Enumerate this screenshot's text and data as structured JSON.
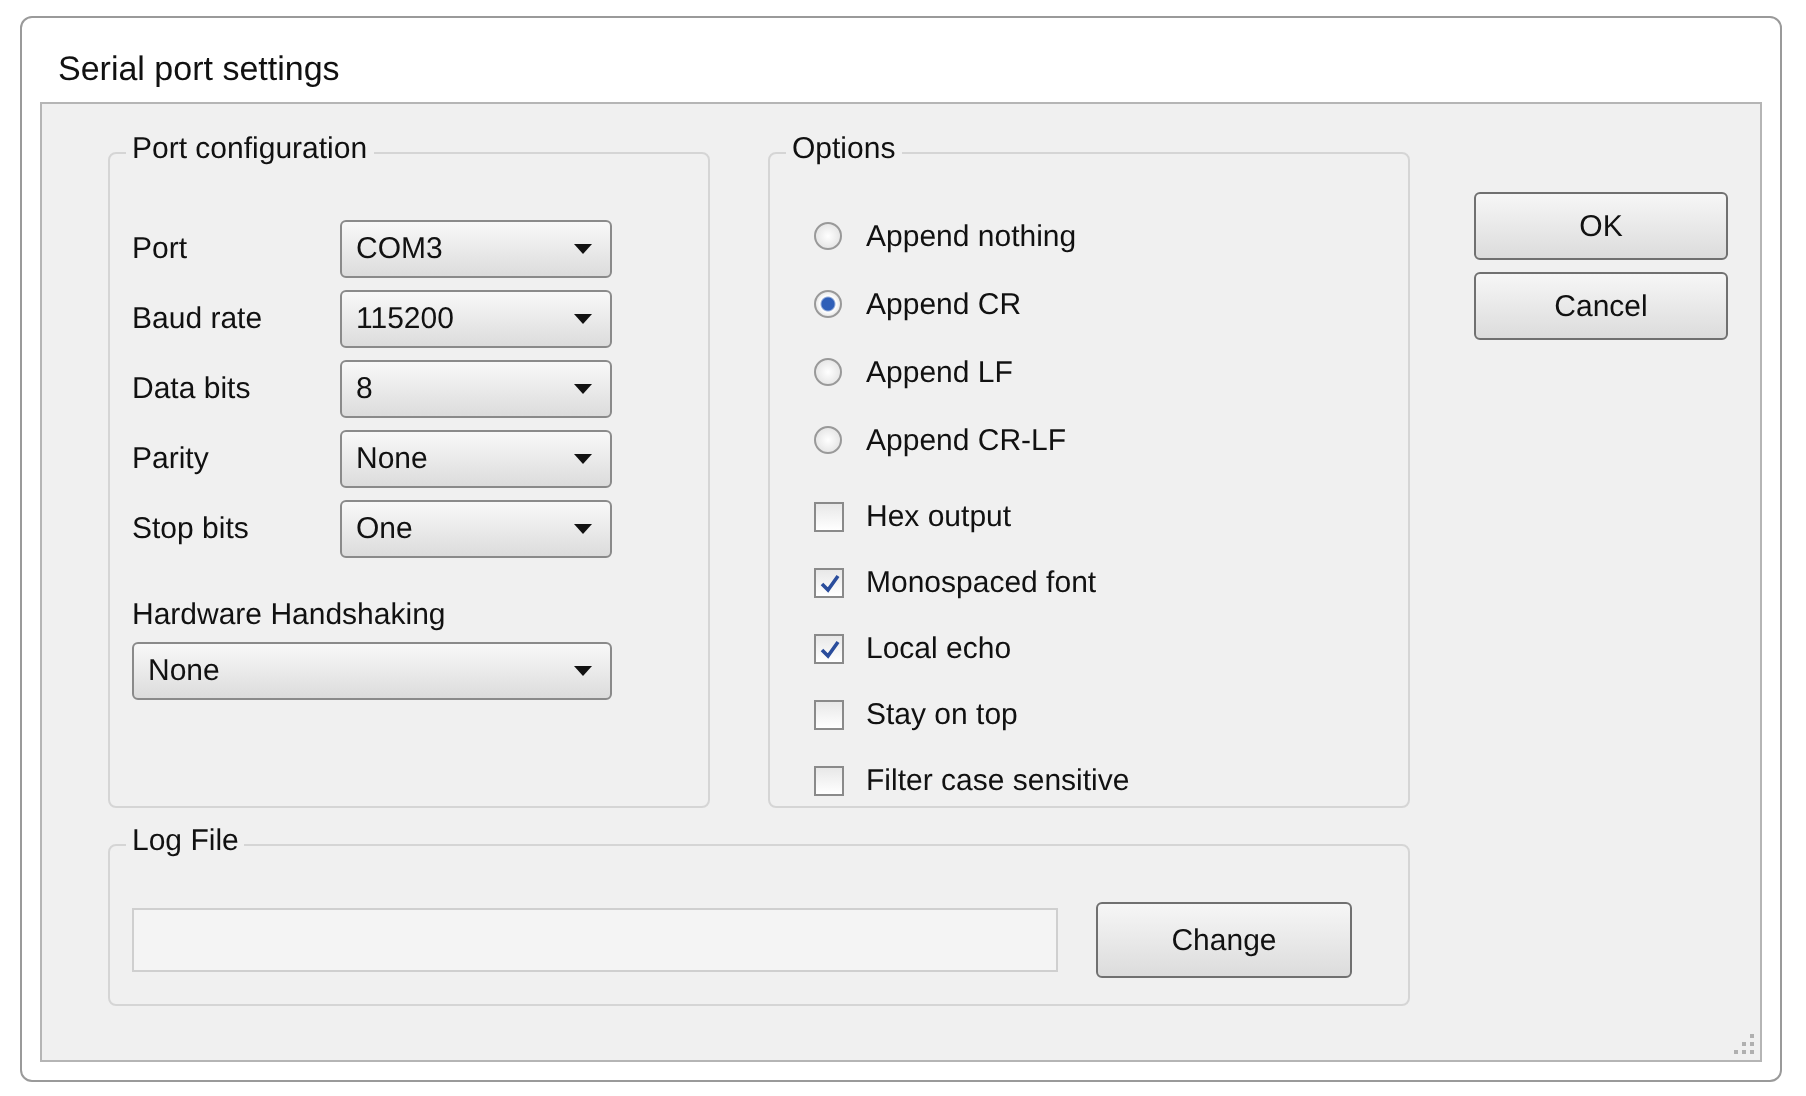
{
  "window": {
    "title": "Serial port settings"
  },
  "port_configuration": {
    "title": "Port configuration",
    "fields": [
      {
        "label": "Port",
        "value": "COM3"
      },
      {
        "label": "Baud rate",
        "value": "115200"
      },
      {
        "label": "Data bits",
        "value": "8"
      },
      {
        "label": "Parity",
        "value": "None"
      },
      {
        "label": "Stop bits",
        "value": "One"
      }
    ],
    "hardware_handshaking": {
      "label": "Hardware Handshaking",
      "value": "None"
    }
  },
  "options": {
    "title": "Options",
    "radios": [
      {
        "label": "Append nothing",
        "selected": false
      },
      {
        "label": "Append CR",
        "selected": true
      },
      {
        "label": "Append LF",
        "selected": false
      },
      {
        "label": "Append CR-LF",
        "selected": false
      }
    ],
    "checkboxes": [
      {
        "label": "Hex output",
        "checked": false
      },
      {
        "label": "Monospaced font",
        "checked": true
      },
      {
        "label": "Local echo",
        "checked": true
      },
      {
        "label": "Stay on top",
        "checked": false
      },
      {
        "label": "Filter case sensitive",
        "checked": false
      }
    ]
  },
  "buttons": [
    "OK",
    "Cancel"
  ],
  "log_file": {
    "title": "Log File",
    "button": "Change"
  }
}
